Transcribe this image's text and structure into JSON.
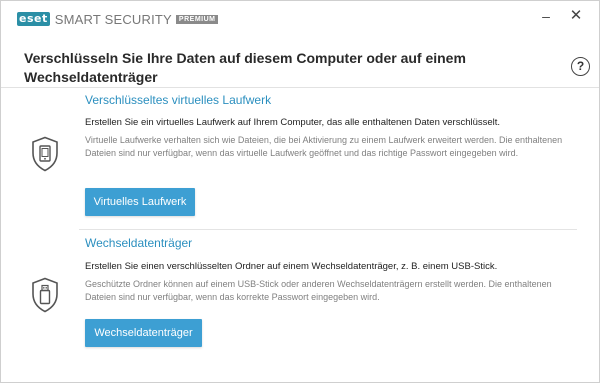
{
  "app": {
    "logo_mark": "eset",
    "product_name": "SMART SECURITY",
    "edition_badge": "PREMIUM",
    "minimize_icon": "minimize-icon",
    "close_icon": "close-icon"
  },
  "header": {
    "title": "Verschlüsseln Sie Ihre Daten auf diesem Computer oder auf einem Wechseldatenträger",
    "help_label": "?"
  },
  "sections": [
    {
      "icon": "shield-virtual-drive-icon",
      "title": "Verschlüsseltes virtuelles Laufwerk",
      "main_text": "Erstellen Sie ein virtuelles Laufwerk auf Ihrem Computer, das alle enthaltenen Daten verschlüsselt.",
      "description": "Virtuelle Laufwerke verhalten sich wie Dateien, die bei Aktivierung zu einem Laufwerk erweitert werden. Die enthaltenen Dateien sind nur verfügbar, wenn das virtuelle Laufwerk geöffnet und das richtige Passwort eingegeben wird.",
      "button_label": "Virtuelles Laufwerk"
    },
    {
      "icon": "shield-usb-icon",
      "title": "Wechseldatenträger",
      "main_text": "Erstellen Sie einen verschlüsselten Ordner auf einem Wechseldatenträger, z. B. einem USB-Stick.",
      "description": "Geschützte Ordner können auf einem USB-Stick oder anderen Wechseldatenträgern erstellt werden. Die enthaltenen Dateien sind nur verfügbar, wenn das korrekte Passwort eingegeben wird.",
      "button_label": "Wechseldatenträger"
    }
  ],
  "colors": {
    "accent": "#3d9fd3",
    "link": "#2b8fbf",
    "logo": "#2b8fa6"
  }
}
